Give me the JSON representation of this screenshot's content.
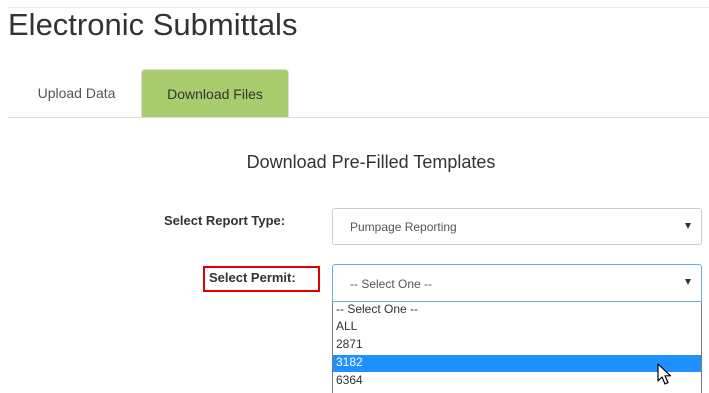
{
  "header": {
    "title": "Electronic Submittals"
  },
  "tabs": [
    {
      "label": "Upload Data",
      "active": false
    },
    {
      "label": "Download Files",
      "active": true
    }
  ],
  "form": {
    "section_title": "Download Pre-Filled Templates",
    "report_type": {
      "label": "Select Report Type:",
      "value": "Pumpage Reporting"
    },
    "permit": {
      "label": "Select Permit:",
      "value": "-- Select One --",
      "options": [
        "-- Select One --",
        "ALL",
        "2871",
        "3182",
        "6364"
      ],
      "highlighted_option": "3182"
    }
  },
  "colors": {
    "active_tab": "#a9cc6c",
    "highlight_box": "#dd0000",
    "option_highlight": "#1e90ff",
    "focus_border": "#66afe9"
  },
  "icons": {
    "select_caret": "caret-down-icon",
    "mouse_cursor": "mouse-pointer-icon"
  }
}
